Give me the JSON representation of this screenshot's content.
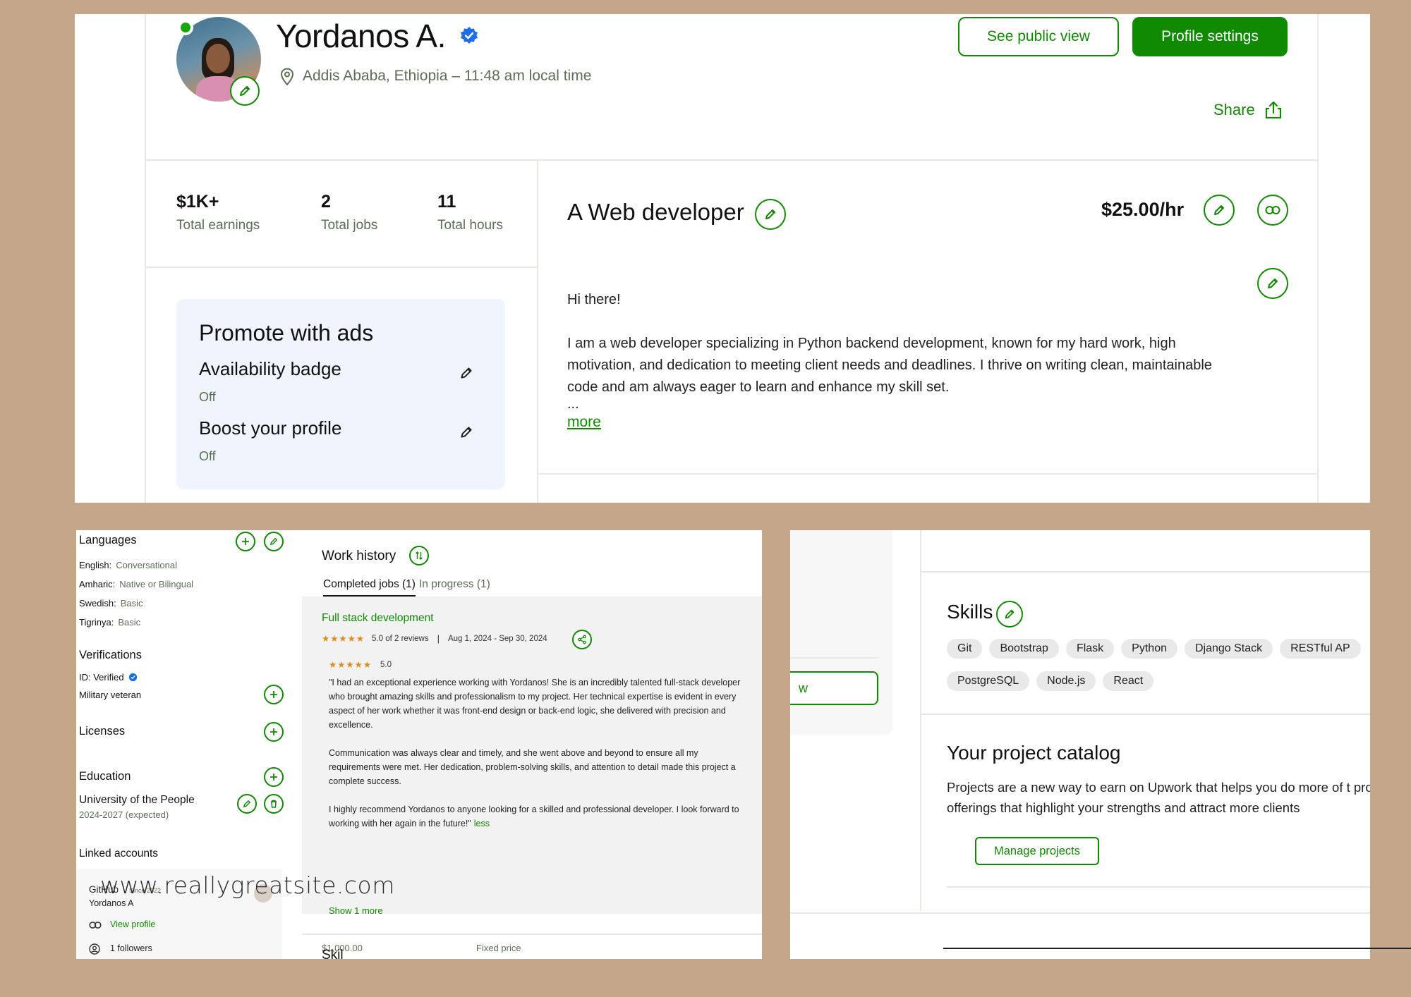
{
  "header": {
    "name": "Yordanos A.",
    "location": "Addis Ababa, Ethiopia – 11:48 am local time",
    "see_public_label": "See public view",
    "settings_label": "Profile settings",
    "share_label": "Share"
  },
  "stats": [
    {
      "value": "$1K+",
      "label": "Total earnings"
    },
    {
      "value": "2",
      "label": "Total jobs"
    },
    {
      "value": "11",
      "label": "Total hours"
    }
  ],
  "promo": {
    "title": "Promote with ads",
    "items": [
      {
        "title": "Availability badge",
        "status": "Off"
      },
      {
        "title": "Boost your profile",
        "status": "Off"
      }
    ]
  },
  "profile": {
    "headline": "A Web developer",
    "rate": "$25.00/hr",
    "overview_greeting": "Hi there!",
    "overview_body": "I am a web developer specializing in Python backend development, known for my hard work, high motivation, and dedication to meeting client needs and deadlines. I thrive on writing clean, maintainable code and am always eager to learn and enhance my skill set.",
    "overview_ellipsis": "...",
    "more_label": "more"
  },
  "sidebar": {
    "languages_title": "Languages",
    "languages": [
      {
        "name": "English:",
        "level": "Conversational"
      },
      {
        "name": "Amharic:",
        "level": "Native or Bilingual"
      },
      {
        "name": "Swedish:",
        "level": "Basic"
      },
      {
        "name": "Tigrinya:",
        "level": "Basic"
      }
    ],
    "verifications_title": "Verifications",
    "id_verified": "ID: Verified",
    "military_veteran": "Military veteran",
    "licenses_title": "Licenses",
    "education_title": "Education",
    "school": "University of the People",
    "school_years": "2024-2027 (expected)",
    "linked_title": "Linked accounts",
    "github_label": "GitHub",
    "github_since": "Since 2022",
    "github_user": "Yordanos A",
    "view_profile_label": "View profile",
    "followers_label": "1 followers"
  },
  "work_history": {
    "title": "Work history",
    "tab_completed": "Completed jobs (1)",
    "tab_progress": "In progress (1)",
    "job_title": "Full stack development",
    "job_stars": "★★★★★",
    "job_rating_text": "5.0 of 2 reviews",
    "job_separator": "|",
    "job_dates": "Aug 1, 2024 - Sep 30, 2024",
    "review_stars": "★★★★★",
    "review_score": "5.0",
    "review_p1": "\"I had an exceptional experience working with Yordanos! She is an incredibly talented full-stack developer who brought amazing skills and professionalism to my project. Her technical expertise is evident in every aspect of her work whether it was front-end design or back-end logic, she delivered with precision and excellence.",
    "review_p2": "Communication was always clear and timely, and she went above and beyond to ensure all my requirements were met. Her dedication, problem-solving skills, and attention to detail made this project a complete success.",
    "review_p3": "I highly recommend Yordanos to anyone looking for a skilled and professional developer. I look forward to working with her again in the future!\"",
    "less_label": "less",
    "show_more_label": "Show 1 more",
    "price_value": "$1,000.00",
    "price_type": "Fixed price",
    "next_section": "Skil"
  },
  "watermark": "www.reallygreatsite.com",
  "right_panel": {
    "side_button_label": "w",
    "skills_title": "Skills",
    "skills": [
      "Git",
      "Bootstrap",
      "Flask",
      "Python",
      "Django Stack",
      "RESTful AP",
      "PostgreSQL",
      "Node.js",
      "React"
    ],
    "catalog_title": "Your project catalog",
    "catalog_desc": "Projects are a new way to earn on Upwork that helps you do more of t project offerings that highlight your strengths and attract more clients",
    "manage_label": "Manage projects"
  },
  "colors": {
    "accent": "#108a00",
    "background": "#c4a68a",
    "verified": "#1c6ee8"
  }
}
